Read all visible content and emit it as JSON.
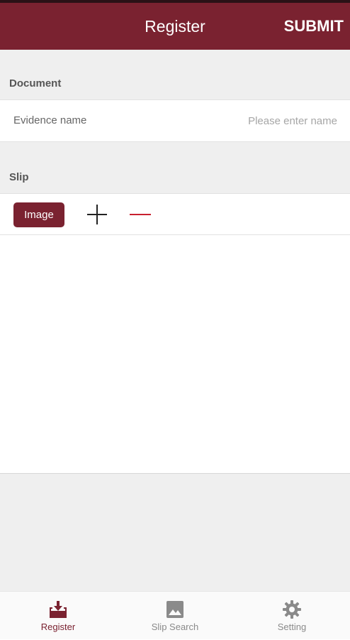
{
  "header": {
    "title": "Register",
    "submit_label": "SUBMIT"
  },
  "document_section": {
    "title": "Document",
    "evidence_field": {
      "label": "Evidence name",
      "value": "",
      "placeholder": "Please enter name"
    }
  },
  "slip_section": {
    "title": "Slip",
    "image_button_label": "Image",
    "add_icon": "plus-icon",
    "remove_icon": "minus-icon"
  },
  "bottom_nav": {
    "items": [
      {
        "label": "Register",
        "icon": "inbox-download-icon",
        "active": true
      },
      {
        "label": "Slip Search",
        "icon": "image-icon",
        "active": false
      },
      {
        "label": "Setting",
        "icon": "gear-icon",
        "active": false
      }
    ]
  },
  "colors": {
    "brand": "#7a2230",
    "remove_accent": "#c8202f",
    "section_background": "#efefef",
    "inactive_nav": "#8a8a8a"
  }
}
